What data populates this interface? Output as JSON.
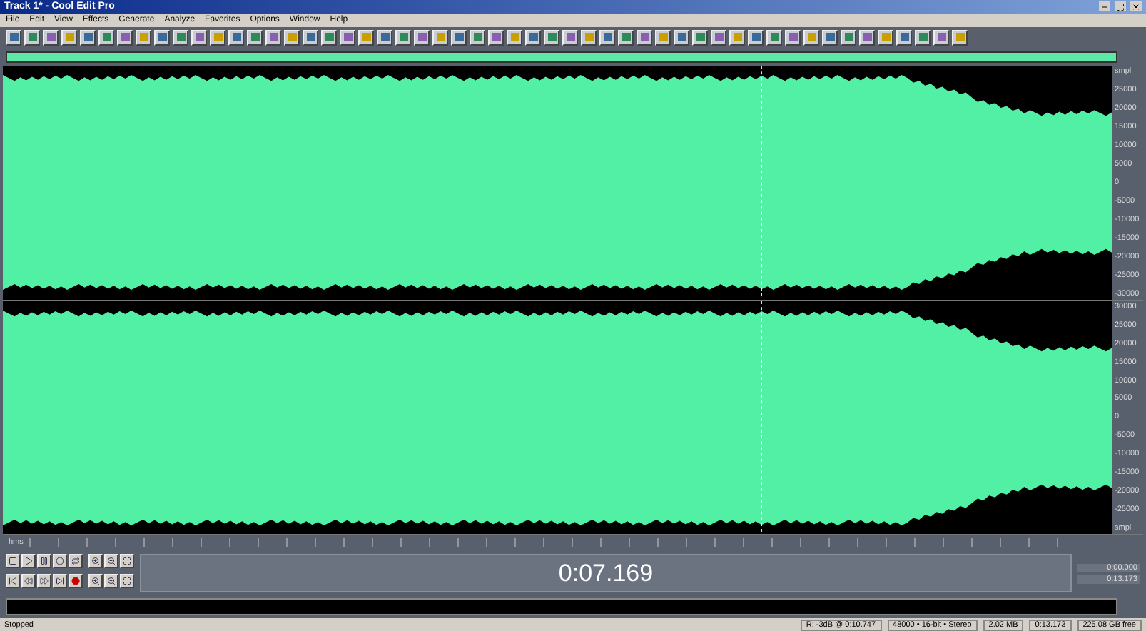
{
  "window": {
    "title": "Track 1* - Cool Edit Pro"
  },
  "menu": [
    "File",
    "Edit",
    "View",
    "Effects",
    "Generate",
    "Analyze",
    "Favorites",
    "Options",
    "Window",
    "Help"
  ],
  "channels": [
    {
      "axis": [
        "smpl",
        "25000",
        "20000",
        "15000",
        "10000",
        "5000",
        "0",
        "-5000",
        "-10000",
        "-15000",
        "-20000",
        "-25000",
        "-30000"
      ]
    },
    {
      "axis": [
        "30000",
        "25000",
        "20000",
        "15000",
        "10000",
        "5000",
        "0",
        "-5000",
        "-10000",
        "-15000",
        "-20000",
        "-25000",
        "smpl"
      ]
    }
  ],
  "ruler": {
    "unit": "hms"
  },
  "time_display": "0:07.169",
  "selection": {
    "begin": "0:00.000",
    "end": "0:13.173"
  },
  "status_bar": [
    "Stopped",
    "R: -3dB @ 0:10.747",
    "48000 • 16-bit • Stereo",
    "2.02 MB",
    "0:13.173",
    "225.08 GB free"
  ]
}
